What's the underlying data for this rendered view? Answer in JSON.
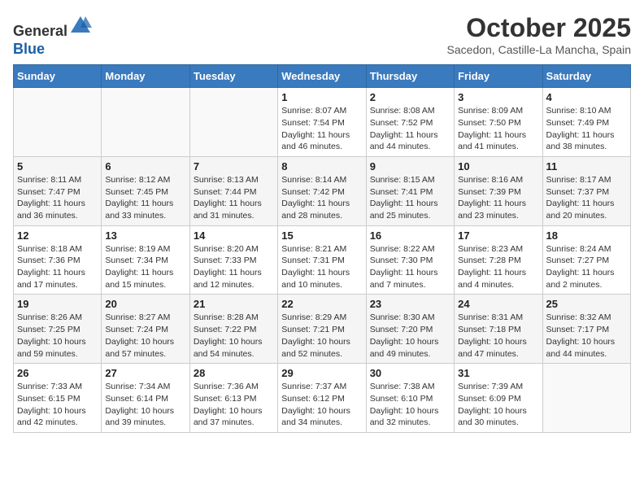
{
  "header": {
    "logo_line1": "General",
    "logo_line2": "Blue",
    "month_title": "October 2025",
    "subtitle": "Sacedon, Castille-La Mancha, Spain"
  },
  "weekdays": [
    "Sunday",
    "Monday",
    "Tuesday",
    "Wednesday",
    "Thursday",
    "Friday",
    "Saturday"
  ],
  "weeks": [
    [
      {
        "day": "",
        "info": ""
      },
      {
        "day": "",
        "info": ""
      },
      {
        "day": "",
        "info": ""
      },
      {
        "day": "1",
        "info": "Sunrise: 8:07 AM\nSunset: 7:54 PM\nDaylight: 11 hours and 46 minutes."
      },
      {
        "day": "2",
        "info": "Sunrise: 8:08 AM\nSunset: 7:52 PM\nDaylight: 11 hours and 44 minutes."
      },
      {
        "day": "3",
        "info": "Sunrise: 8:09 AM\nSunset: 7:50 PM\nDaylight: 11 hours and 41 minutes."
      },
      {
        "day": "4",
        "info": "Sunrise: 8:10 AM\nSunset: 7:49 PM\nDaylight: 11 hours and 38 minutes."
      }
    ],
    [
      {
        "day": "5",
        "info": "Sunrise: 8:11 AM\nSunset: 7:47 PM\nDaylight: 11 hours and 36 minutes."
      },
      {
        "day": "6",
        "info": "Sunrise: 8:12 AM\nSunset: 7:45 PM\nDaylight: 11 hours and 33 minutes."
      },
      {
        "day": "7",
        "info": "Sunrise: 8:13 AM\nSunset: 7:44 PM\nDaylight: 11 hours and 31 minutes."
      },
      {
        "day": "8",
        "info": "Sunrise: 8:14 AM\nSunset: 7:42 PM\nDaylight: 11 hours and 28 minutes."
      },
      {
        "day": "9",
        "info": "Sunrise: 8:15 AM\nSunset: 7:41 PM\nDaylight: 11 hours and 25 minutes."
      },
      {
        "day": "10",
        "info": "Sunrise: 8:16 AM\nSunset: 7:39 PM\nDaylight: 11 hours and 23 minutes."
      },
      {
        "day": "11",
        "info": "Sunrise: 8:17 AM\nSunset: 7:37 PM\nDaylight: 11 hours and 20 minutes."
      }
    ],
    [
      {
        "day": "12",
        "info": "Sunrise: 8:18 AM\nSunset: 7:36 PM\nDaylight: 11 hours and 17 minutes."
      },
      {
        "day": "13",
        "info": "Sunrise: 8:19 AM\nSunset: 7:34 PM\nDaylight: 11 hours and 15 minutes."
      },
      {
        "day": "14",
        "info": "Sunrise: 8:20 AM\nSunset: 7:33 PM\nDaylight: 11 hours and 12 minutes."
      },
      {
        "day": "15",
        "info": "Sunrise: 8:21 AM\nSunset: 7:31 PM\nDaylight: 11 hours and 10 minutes."
      },
      {
        "day": "16",
        "info": "Sunrise: 8:22 AM\nSunset: 7:30 PM\nDaylight: 11 hours and 7 minutes."
      },
      {
        "day": "17",
        "info": "Sunrise: 8:23 AM\nSunset: 7:28 PM\nDaylight: 11 hours and 4 minutes."
      },
      {
        "day": "18",
        "info": "Sunrise: 8:24 AM\nSunset: 7:27 PM\nDaylight: 11 hours and 2 minutes."
      }
    ],
    [
      {
        "day": "19",
        "info": "Sunrise: 8:26 AM\nSunset: 7:25 PM\nDaylight: 10 hours and 59 minutes."
      },
      {
        "day": "20",
        "info": "Sunrise: 8:27 AM\nSunset: 7:24 PM\nDaylight: 10 hours and 57 minutes."
      },
      {
        "day": "21",
        "info": "Sunrise: 8:28 AM\nSunset: 7:22 PM\nDaylight: 10 hours and 54 minutes."
      },
      {
        "day": "22",
        "info": "Sunrise: 8:29 AM\nSunset: 7:21 PM\nDaylight: 10 hours and 52 minutes."
      },
      {
        "day": "23",
        "info": "Sunrise: 8:30 AM\nSunset: 7:20 PM\nDaylight: 10 hours and 49 minutes."
      },
      {
        "day": "24",
        "info": "Sunrise: 8:31 AM\nSunset: 7:18 PM\nDaylight: 10 hours and 47 minutes."
      },
      {
        "day": "25",
        "info": "Sunrise: 8:32 AM\nSunset: 7:17 PM\nDaylight: 10 hours and 44 minutes."
      }
    ],
    [
      {
        "day": "26",
        "info": "Sunrise: 7:33 AM\nSunset: 6:15 PM\nDaylight: 10 hours and 42 minutes."
      },
      {
        "day": "27",
        "info": "Sunrise: 7:34 AM\nSunset: 6:14 PM\nDaylight: 10 hours and 39 minutes."
      },
      {
        "day": "28",
        "info": "Sunrise: 7:36 AM\nSunset: 6:13 PM\nDaylight: 10 hours and 37 minutes."
      },
      {
        "day": "29",
        "info": "Sunrise: 7:37 AM\nSunset: 6:12 PM\nDaylight: 10 hours and 34 minutes."
      },
      {
        "day": "30",
        "info": "Sunrise: 7:38 AM\nSunset: 6:10 PM\nDaylight: 10 hours and 32 minutes."
      },
      {
        "day": "31",
        "info": "Sunrise: 7:39 AM\nSunset: 6:09 PM\nDaylight: 10 hours and 30 minutes."
      },
      {
        "day": "",
        "info": ""
      }
    ]
  ]
}
